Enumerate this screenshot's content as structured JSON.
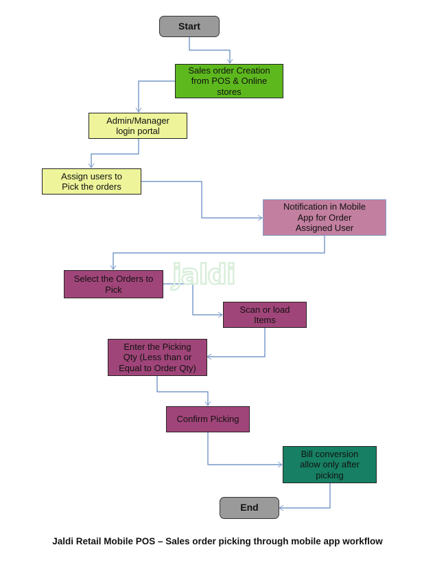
{
  "diagram": {
    "caption": "Jaldi Retail Mobile POS – Sales order picking through mobile app workflow",
    "watermark": "jaldi",
    "colors": {
      "terminal": "#9a9a9a",
      "sales_green": "#5db81e",
      "admin_yellow": "#eef49a",
      "notification_pink": "#c27f9f",
      "process_purple": "#a04579",
      "bill_teal": "#177f63",
      "connector": "#5b83bd",
      "watermark": "#d9eedb"
    },
    "nodes": [
      {
        "id": "start",
        "label": "Start",
        "shape": "terminal"
      },
      {
        "id": "sales-order-creation",
        "label": "Sales order Creation\nfrom POS & Online\nstores",
        "shape": "process"
      },
      {
        "id": "admin-login",
        "label": "Admin/Manager\nlogin portal",
        "shape": "process"
      },
      {
        "id": "assign-users",
        "label": "Assign users to\nPick the orders",
        "shape": "process"
      },
      {
        "id": "notification",
        "label": "Notification in Mobile\nApp for Order\nAssigned User",
        "shape": "process"
      },
      {
        "id": "select-orders",
        "label": "Select the Orders to\nPick",
        "shape": "process"
      },
      {
        "id": "scan-items",
        "label": "Scan or load\nItems",
        "shape": "process"
      },
      {
        "id": "enter-qty",
        "label": "Enter the Picking\nQty (Less than or\nEqual to Order Qty)",
        "shape": "process"
      },
      {
        "id": "confirm-picking",
        "label": "Confirm Picking",
        "shape": "process"
      },
      {
        "id": "bill-conversion",
        "label": "Bill conversion\nallow only after\npicking",
        "shape": "process"
      },
      {
        "id": "end",
        "label": "End",
        "shape": "terminal"
      }
    ],
    "edges": [
      {
        "from": "start",
        "to": "sales-order-creation"
      },
      {
        "from": "sales-order-creation",
        "to": "admin-login"
      },
      {
        "from": "admin-login",
        "to": "assign-users"
      },
      {
        "from": "assign-users",
        "to": "notification"
      },
      {
        "from": "notification",
        "to": "select-orders"
      },
      {
        "from": "select-orders",
        "to": "scan-items"
      },
      {
        "from": "scan-items",
        "to": "enter-qty"
      },
      {
        "from": "enter-qty",
        "to": "confirm-picking"
      },
      {
        "from": "confirm-picking",
        "to": "bill-conversion"
      },
      {
        "from": "bill-conversion",
        "to": "end"
      }
    ]
  }
}
